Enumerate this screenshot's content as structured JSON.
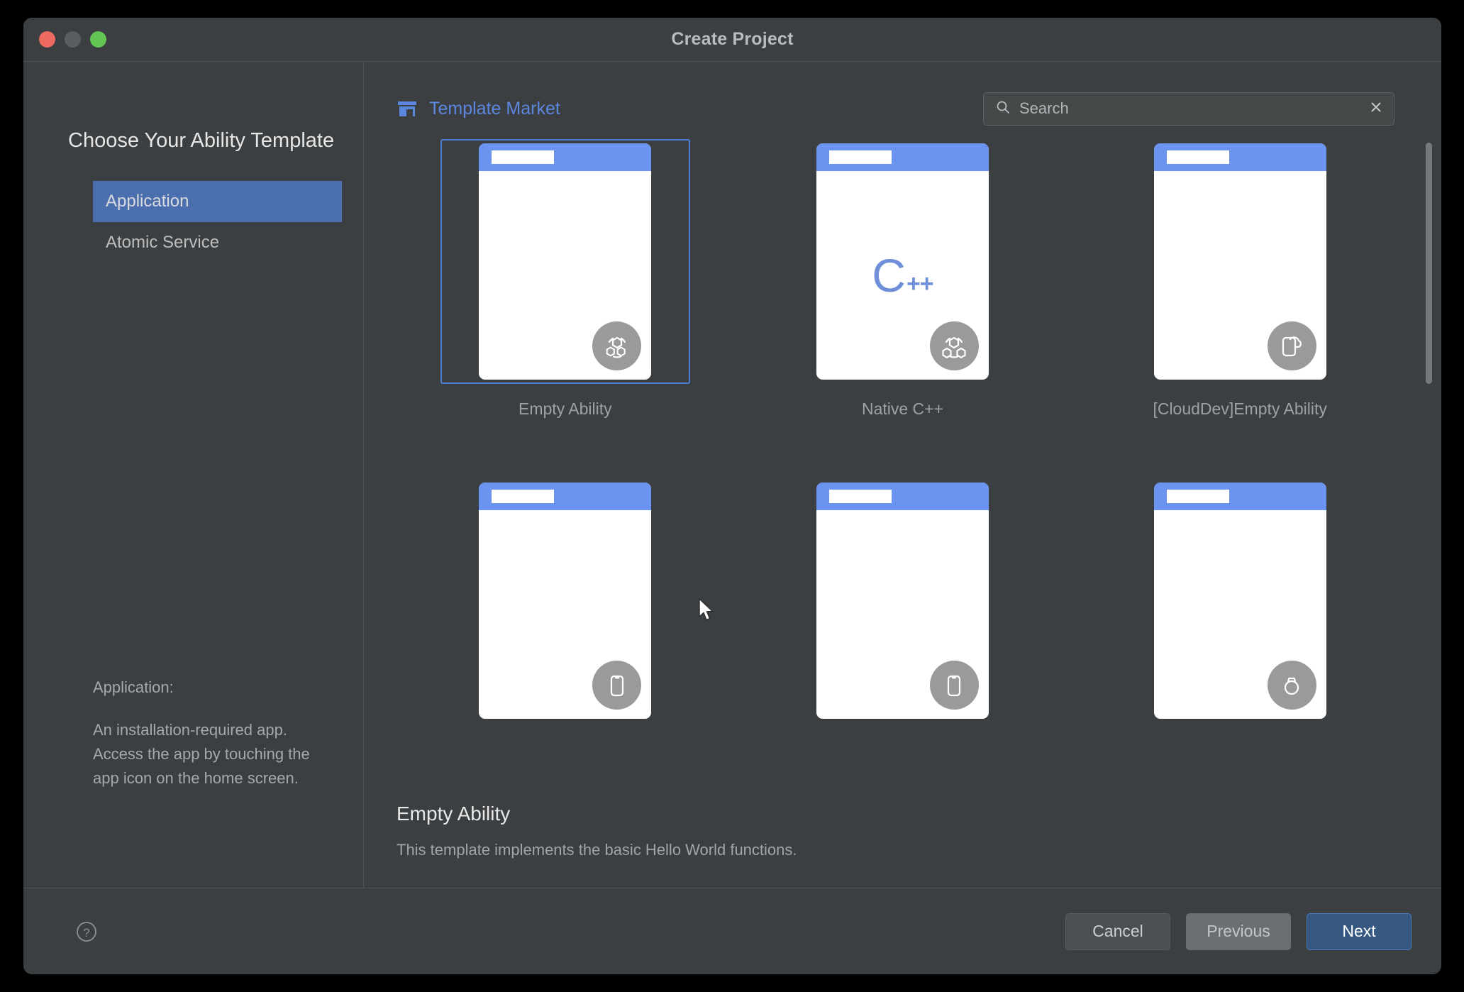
{
  "window": {
    "title": "Create Project",
    "traffic_lights": [
      "close",
      "minimize",
      "maximize"
    ]
  },
  "sidebar": {
    "heading": "Choose Your Ability Template",
    "items": [
      {
        "label": "Application",
        "selected": true
      },
      {
        "label": "Atomic Service",
        "selected": false
      }
    ],
    "description_title": "Application:",
    "description_body": "An installation-required app. Access the app by touching the app icon on the home screen."
  },
  "main": {
    "market_link_label": "Template Market",
    "market_icon": "storefront-icon",
    "search": {
      "placeholder": "Search",
      "value": "",
      "search_icon": "search-icon",
      "clear_icon": "close-icon"
    },
    "templates": [
      {
        "label": "Empty Ability",
        "selected": true,
        "badge": "atom-icon",
        "center_art": "none"
      },
      {
        "label": "Native C++",
        "selected": false,
        "badge": "atom-icon",
        "center_art": "cpp-logo",
        "cpp_text": "C",
        "cpp_plus": "++"
      },
      {
        "label": "[CloudDev]Empty Ability",
        "selected": false,
        "badge": "phone-cloud-icon",
        "center_art": "none"
      },
      {
        "label": "",
        "selected": false,
        "badge": "phone-icon",
        "center_art": "none"
      },
      {
        "label": "",
        "selected": false,
        "badge": "phone-icon",
        "center_art": "none"
      },
      {
        "label": "",
        "selected": false,
        "badge": "watch-icon",
        "center_art": "none"
      }
    ],
    "scrollbar": {
      "name": "vertical-scrollbar"
    }
  },
  "detail": {
    "title": "Empty Ability",
    "description": "This template implements the basic Hello World functions."
  },
  "footer": {
    "help_icon": "help-icon",
    "buttons": [
      {
        "label": "Cancel",
        "style": "default"
      },
      {
        "label": "Previous",
        "style": "hover"
      },
      {
        "label": "Next",
        "style": "primary"
      }
    ]
  },
  "colors": {
    "window_bg": "#3c3f41",
    "accent_blue": "#5c87e0",
    "selection_blue": "#4b6eaf",
    "primary_button": "#365880",
    "phone_header": "#6b93f0",
    "badge_gray": "#9a9a9a"
  }
}
